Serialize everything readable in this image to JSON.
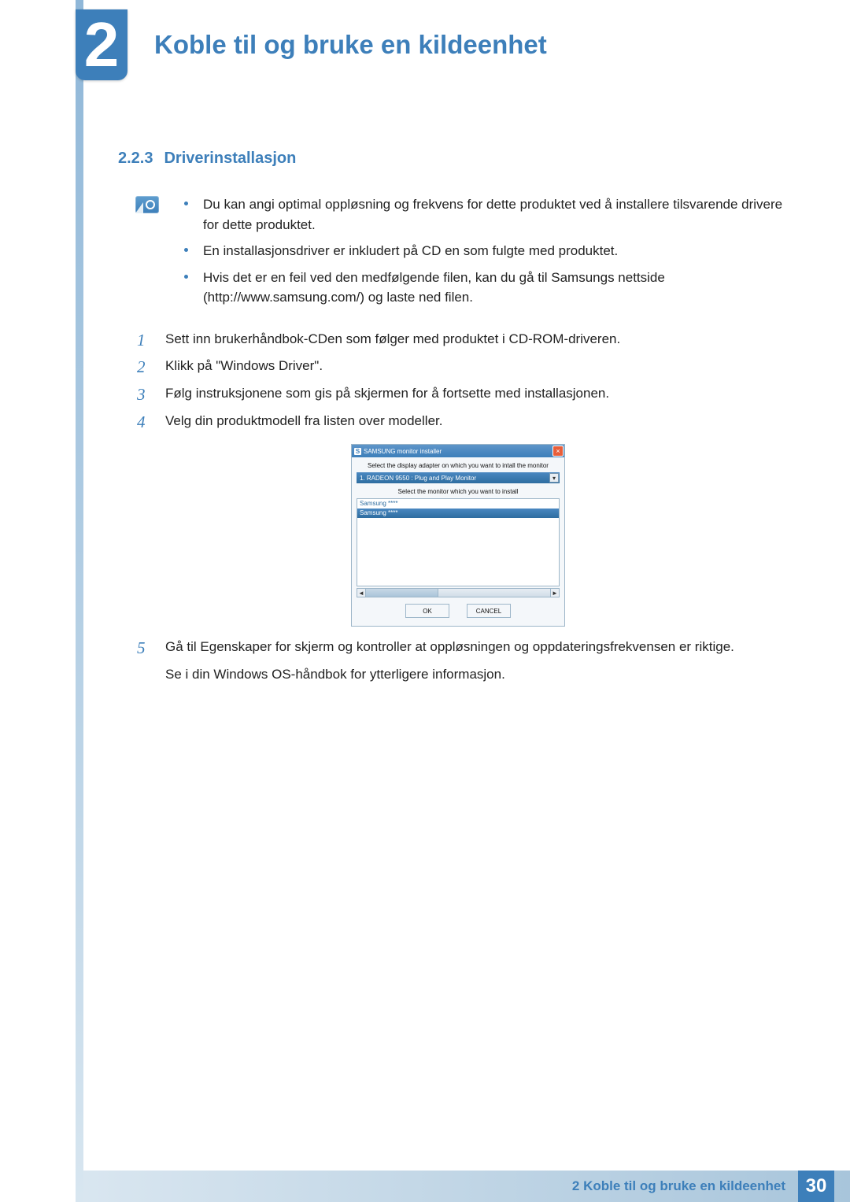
{
  "chapter": {
    "number": "2",
    "title": "Koble til og bruke en kildeenhet"
  },
  "section": {
    "number": "2.2.3",
    "title": "Driverinstallasjon"
  },
  "note_bullets": [
    "Du kan angi optimal oppløsning og frekvens for dette produktet ved å installere tilsvarende drivere for dette produktet.",
    "En installasjonsdriver er inkludert på CD en som fulgte med produktet.",
    "Hvis det er en feil ved den medfølgende filen, kan du gå til Samsungs nettside (http://www.samsung.com/) og laste ned filen."
  ],
  "steps": {
    "s1": "Sett inn brukerhåndbok-CDen som følger med produktet i CD-ROM-driveren.",
    "s2": "Klikk på \"Windows Driver\".",
    "s3": "Følg instruksjonene som gis på skjermen for å fortsette med installasjonen.",
    "s4": "Velg din produktmodell fra listen over modeller.",
    "s5a": "Gå til Egenskaper for skjerm og kontroller at oppløsningen og oppdateringsfrekvensen er riktige.",
    "s5b": "Se i din Windows OS-håndbok for ytterligere informasjon."
  },
  "installer": {
    "title": "SAMSUNG monitor installer",
    "app_glyph": "S",
    "close_glyph": "×",
    "prompt_adapter": "Select the display adapter on which you want to intall the monitor",
    "adapter_selected": "1. RADEON 9550 : Plug and Play Monitor",
    "dropdown_glyph": "▾",
    "prompt_monitor": "Select the monitor which you want to install",
    "list_item_0": "Samsung ****",
    "list_item_1": "Samsung ****",
    "arrow_left": "◄",
    "arrow_right": "►",
    "ok": "OK",
    "cancel": "CANCEL"
  },
  "footer": {
    "text": "2 Koble til og bruke en kildeenhet",
    "page": "30"
  }
}
